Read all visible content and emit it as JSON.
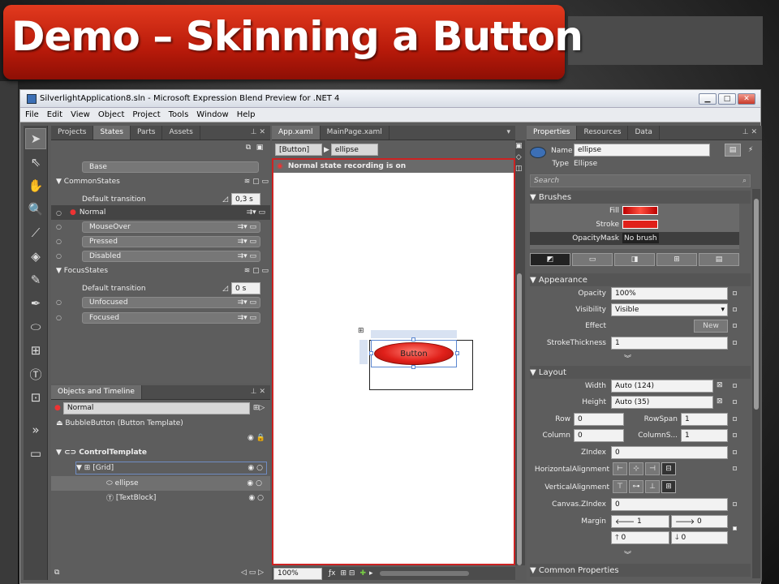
{
  "slide": {
    "title": "Demo – Skinning a Button"
  },
  "window": {
    "title": "SilverlightApplication8.sln - Microsoft Expression Blend Preview for .NET 4",
    "menu": [
      "File",
      "Edit",
      "View",
      "Object",
      "Project",
      "Tools",
      "Window",
      "Help"
    ]
  },
  "left_tabs": [
    "Projects",
    "States",
    "Parts",
    "Assets"
  ],
  "states": {
    "base": "Base",
    "groups": [
      {
        "name": "CommonStates",
        "default_transition": "Default transition",
        "transition_value": "0,3 s",
        "items": [
          "Normal",
          "MouseOver",
          "Pressed",
          "Disabled"
        ]
      },
      {
        "name": "FocusStates",
        "default_transition": "Default transition",
        "transition_value": "0 s",
        "items": [
          "Unfocused",
          "Focused"
        ]
      }
    ]
  },
  "objects": {
    "tab": "Objects and Timeline",
    "state": "Normal",
    "scope": "BubbleButton (Button Template)",
    "tree": [
      "ControlTemplate",
      "[Grid]",
      "ellipse",
      "[TextBlock]"
    ]
  },
  "doc_tabs": [
    "App.xaml",
    "MainPage.xaml"
  ],
  "breadcrumb": [
    "[Button]",
    "ellipse"
  ],
  "recording": "Normal state recording is on",
  "canvas": {
    "button_label": "Button",
    "zoom": "100%"
  },
  "right_tabs": [
    "Properties",
    "Resources",
    "Data"
  ],
  "props": {
    "name_label": "Name",
    "name_value": "ellipse",
    "type_label": "Type",
    "type_value": "Ellipse",
    "search_placeholder": "Search",
    "brushes": {
      "title": "Brushes",
      "fill": "Fill",
      "stroke": "Stroke",
      "opacity_mask": "OpacityMask",
      "opacity_mask_value": "No brush"
    },
    "appearance": {
      "title": "Appearance",
      "opacity": "Opacity",
      "opacity_value": "100%",
      "visibility": "Visibility",
      "visibility_value": "Visible",
      "effect": "Effect",
      "effect_button": "New",
      "stroke_thickness": "StrokeThickness",
      "stroke_thickness_value": "1"
    },
    "layout": {
      "title": "Layout",
      "width": "Width",
      "width_value": "Auto (124)",
      "height": "Height",
      "height_value": "Auto (35)",
      "row": "Row",
      "row_value": "0",
      "rowspan": "RowSpan",
      "rowspan_value": "1",
      "column": "Column",
      "column_value": "0",
      "columnspan": "ColumnS...",
      "columnspan_value": "1",
      "zindex": "ZIndex",
      "zindex_value": "0",
      "halign": "HorizontalAlignment",
      "valign": "VerticalAlignment",
      "canvas_zindex": "Canvas.ZIndex",
      "canvas_zindex_value": "0",
      "margin": "Margin",
      "margin_left": "1",
      "margin_right": "0",
      "margin_top": "0",
      "margin_bottom": "0"
    },
    "common": "Common Properties"
  },
  "colors": {
    "banner": "#c8240f",
    "fill": "#e0201a",
    "recording": "#cc2222",
    "accent_blue": "#3c6fb5"
  }
}
